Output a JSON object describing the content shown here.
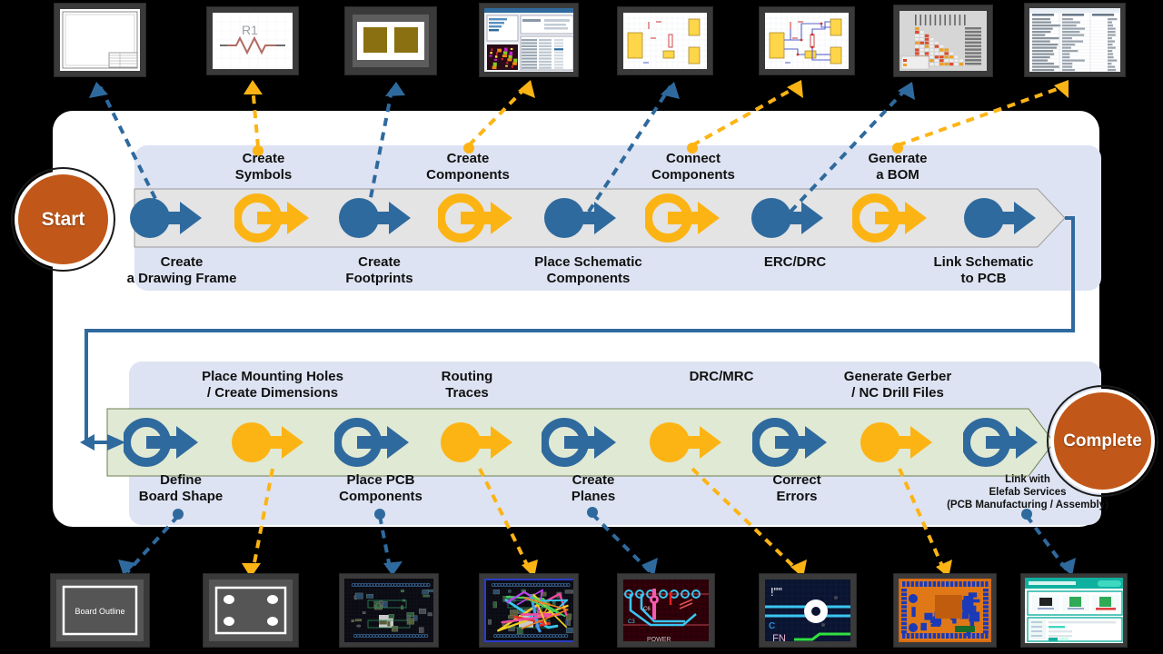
{
  "title": "PCB Design Workflow",
  "colors": {
    "blue": "#2f6a9e",
    "yellow": "#fcb415",
    "orange": "#c1581a",
    "lane": "#dde3f2",
    "band_top": "#e2e2e2",
    "band_bottom": "#dfe8d3",
    "panel": "#ffffff",
    "background": "#000000"
  },
  "endpoints": {
    "start": "Start",
    "complete": "Complete"
  },
  "row1": {
    "steps_below": [
      {
        "label": "Create\na Drawing Frame",
        "color": "blue"
      },
      {
        "label": "Create\nFootprints",
        "color": "blue"
      },
      {
        "label": "Place Schematic\nComponents",
        "color": "blue"
      },
      {
        "label": "ERC/DRC",
        "color": "blue"
      },
      {
        "label": "Link Schematic\nto PCB",
        "color": "blue"
      }
    ],
    "steps_above": [
      {
        "label": "Create\nSymbols",
        "color": "yellow"
      },
      {
        "label": "Create\nComponents",
        "color": "yellow"
      },
      {
        "label": "Connect\nComponents",
        "color": "yellow"
      },
      {
        "label": "Generate\na BOM",
        "color": "yellow"
      }
    ]
  },
  "row2": {
    "steps_below": [
      {
        "label": "Define\nBoard Shape",
        "color": "blue"
      },
      {
        "label": "Place PCB\nComponents",
        "color": "blue"
      },
      {
        "label": "Create\nPlanes",
        "color": "blue"
      },
      {
        "label": "Correct\nErrors",
        "color": "blue"
      },
      {
        "label": "Link with\nElefab Services\n(PCB Manufacturing / Assembly)",
        "color": "blue"
      }
    ],
    "steps_above": [
      {
        "label": "Place Mounting Holes\n/ Create Dimensions",
        "color": "yellow"
      },
      {
        "label": "Routing\nTraces",
        "color": "yellow"
      },
      {
        "label": "DRC/MRC",
        "color": "yellow"
      },
      {
        "label": "Generate Gerber\n/ NC Drill Files",
        "color": "yellow"
      }
    ]
  },
  "thumbnails_top": [
    {
      "name": "drawing-frame-thumbnail",
      "kind": "frame"
    },
    {
      "name": "symbol-editor-thumbnail",
      "kind": "symbol",
      "caption": "R1"
    },
    {
      "name": "footprint-editor-thumbnail",
      "kind": "footprint"
    },
    {
      "name": "component-editor-thumbnail",
      "kind": "dialog"
    },
    {
      "name": "schematic-placed-thumbnail",
      "kind": "schematic-placed"
    },
    {
      "name": "schematic-connected-thumbnail",
      "kind": "schematic-wired"
    },
    {
      "name": "erc-matrix-thumbnail",
      "kind": "erc-matrix"
    },
    {
      "name": "bom-spreadsheet-thumbnail",
      "kind": "bom"
    }
  ],
  "thumbnails_bottom": [
    {
      "name": "board-outline-thumbnail",
      "kind": "board-outline",
      "caption": "Board Outline"
    },
    {
      "name": "mounting-holes-thumbnail",
      "kind": "mounting-holes"
    },
    {
      "name": "pcb-placed-thumbnail",
      "kind": "pcb-placed"
    },
    {
      "name": "pcb-routed-thumbnail",
      "kind": "pcb-routed"
    },
    {
      "name": "pcb-planes-thumbnail",
      "kind": "pcb-planes"
    },
    {
      "name": "drc-zoom-thumbnail",
      "kind": "pcb-drc"
    },
    {
      "name": "gerber-view-thumbnail",
      "kind": "gerber"
    },
    {
      "name": "elefab-service-thumbnail",
      "kind": "web-service"
    }
  ]
}
